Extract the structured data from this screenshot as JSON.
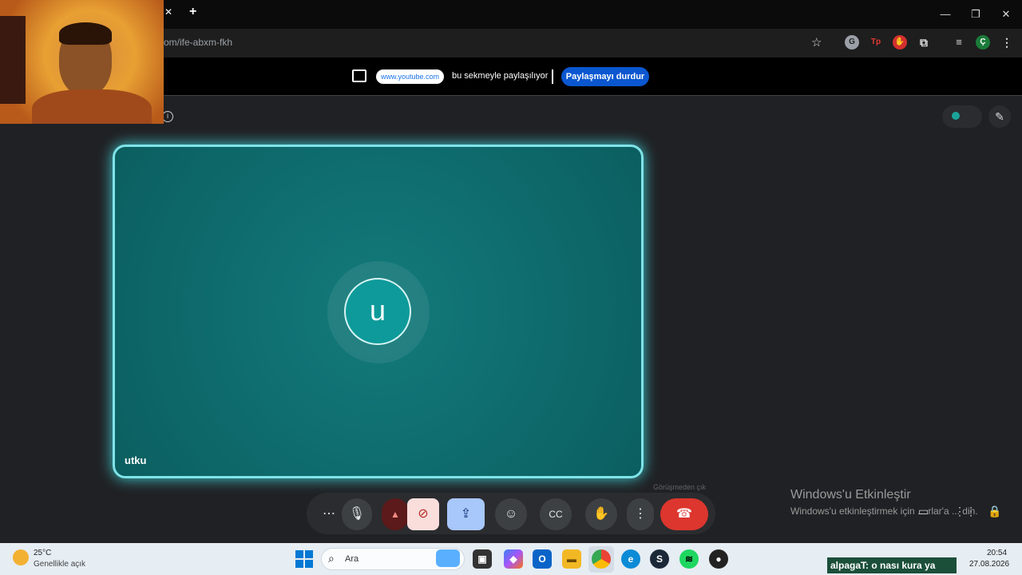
{
  "browser": {
    "url_fragment": "om/ife-abxm-fkh",
    "tab_close": "✕",
    "new_tab": "+",
    "ext_g": "G",
    "ext_tp": "Tp",
    "avatar_letter": "Ç"
  },
  "share_banner": {
    "site": "www.youtube.com",
    "text": "bu sekmeyle paylaşılıyor",
    "stop_label": "Paylaşmayı durdur"
  },
  "meet": {
    "participant_initial": "u",
    "participant_name": "utku",
    "leave_tooltip": "Görüşmeden çık"
  },
  "windows_watermark": {
    "title": "Windows'u Etkinleştir",
    "subtitle": "Windows'u etkinleştirmek için ... rlar'a ... din."
  },
  "taskbar": {
    "temperature": "25°C",
    "weather": "Genellikle açık",
    "search_placeholder": "Ara",
    "chat_overlay": "alpagaT: o nası kura ya",
    "time": "20:54",
    "date": "27.08.2026"
  },
  "colors": {
    "accent": "#0b57d0",
    "tile_border": "#7fe3e8",
    "leave_red": "#dc362e"
  }
}
